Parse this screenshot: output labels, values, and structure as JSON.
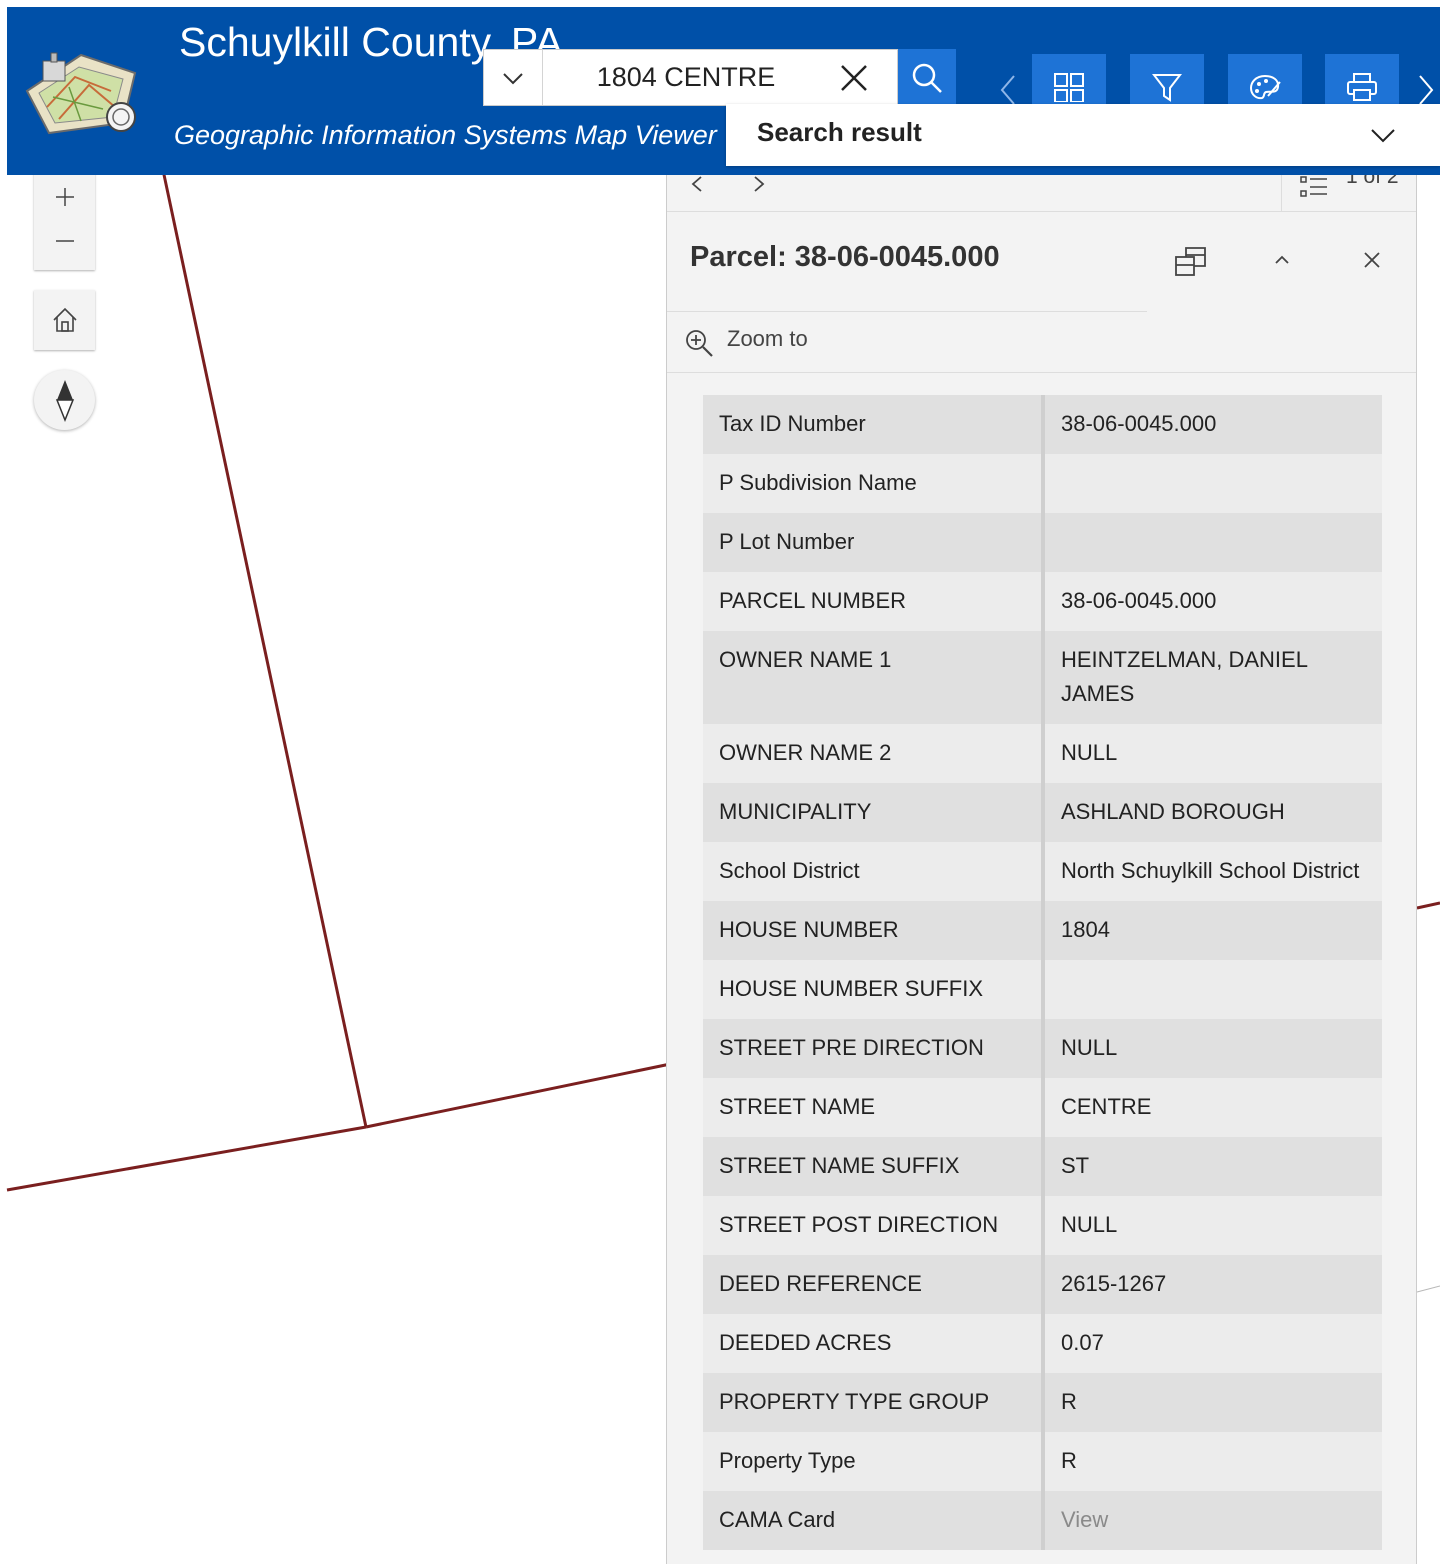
{
  "header": {
    "title": "Schuylkill County, PA",
    "subtitle": "Geographic Information Systems  Map Viewer"
  },
  "search": {
    "value": "1804 CENTRE",
    "icons": {
      "source": "chevron-down-icon",
      "clear": "close-icon",
      "submit": "search-icon"
    }
  },
  "toolbar": {
    "icons": [
      "grid-icon",
      "filter-icon",
      "palette-icon",
      "print-icon"
    ]
  },
  "search_result": {
    "label": "Search result"
  },
  "popup": {
    "pager_count": "1 of 2",
    "title": "Parcel: 38-06-0045.000",
    "zoom_to_label": "Zoom to",
    "attributes": [
      {
        "key": "Tax ID Number",
        "value": "38-06-0045.000"
      },
      {
        "key": "P Subdivision Name",
        "value": ""
      },
      {
        "key": "P Lot Number",
        "value": ""
      },
      {
        "key": "PARCEL NUMBER",
        "value": "38-06-0045.000"
      },
      {
        "key": "OWNER NAME 1",
        "value": "HEINTZELMAN, DANIEL JAMES"
      },
      {
        "key": "OWNER NAME 2",
        "value": "NULL"
      },
      {
        "key": "MUNICIPALITY",
        "value": "ASHLAND BOROUGH"
      },
      {
        "key": "School District",
        "value": "North Schuylkill School District"
      },
      {
        "key": "HOUSE NUMBER",
        "value": "1804"
      },
      {
        "key": "HOUSE NUMBER SUFFIX",
        "value": ""
      },
      {
        "key": "STREET PRE DIRECTION",
        "value": "NULL"
      },
      {
        "key": "STREET NAME",
        "value": "CENTRE"
      },
      {
        "key": "STREET NAME SUFFIX",
        "value": "ST"
      },
      {
        "key": "STREET POST DIRECTION",
        "value": "NULL"
      },
      {
        "key": "DEED REFERENCE",
        "value": "2615-1267"
      },
      {
        "key": "DEEDED ACRES",
        "value": "0.07"
      },
      {
        "key": "PROPERTY TYPE GROUP",
        "value": "R"
      },
      {
        "key": "Property Type",
        "value": "R"
      },
      {
        "key": "CAMA Card",
        "value": "View"
      }
    ]
  },
  "colors": {
    "header": "#0050a8",
    "button": "#1e73d6",
    "parcel_line": "#7a1f1f"
  }
}
